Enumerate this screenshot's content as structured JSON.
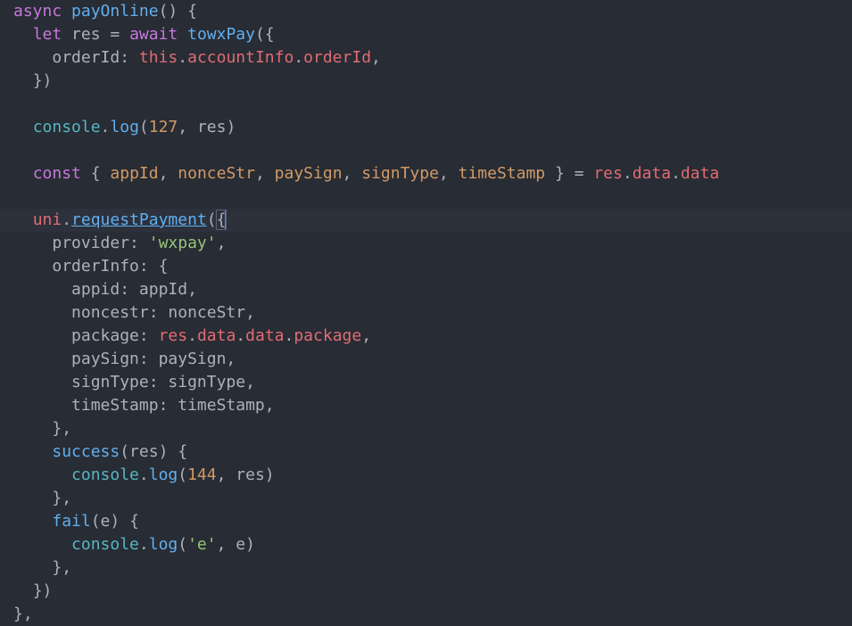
{
  "editor": {
    "lines": [
      [
        {
          "t": "async ",
          "c": "kw"
        },
        {
          "t": "payOnline",
          "c": "fn"
        },
        {
          "t": "() {",
          "c": "punc"
        }
      ],
      [
        {
          "t": "  "
        },
        {
          "t": "let ",
          "c": "kw"
        },
        {
          "t": "res = ",
          "c": "punc"
        },
        {
          "t": "await ",
          "c": "kw"
        },
        {
          "t": "towxPay",
          "c": "fn"
        },
        {
          "t": "({",
          "c": "punc"
        }
      ],
      [
        {
          "t": "    "
        },
        {
          "t": "orderId: ",
          "c": "prop"
        },
        {
          "t": "this",
          "c": "var"
        },
        {
          "t": ".",
          "c": "punc"
        },
        {
          "t": "accountInfo",
          "c": "var"
        },
        {
          "t": ".",
          "c": "punc"
        },
        {
          "t": "orderId",
          "c": "var"
        },
        {
          "t": ",",
          "c": "punc"
        }
      ],
      [
        {
          "t": "  "
        },
        {
          "t": "})",
          "c": "punc"
        }
      ],
      [],
      [
        {
          "t": "  "
        },
        {
          "t": "console",
          "c": "cls"
        },
        {
          "t": ".",
          "c": "punc"
        },
        {
          "t": "log",
          "c": "fn"
        },
        {
          "t": "(",
          "c": "punc"
        },
        {
          "t": "127",
          "c": "num"
        },
        {
          "t": ", res)",
          "c": "punc"
        }
      ],
      [],
      [
        {
          "t": "  "
        },
        {
          "t": "const ",
          "c": "kw"
        },
        {
          "t": "{ ",
          "c": "punc"
        },
        {
          "t": "appId",
          "c": "param"
        },
        {
          "t": ", ",
          "c": "punc"
        },
        {
          "t": "nonceStr",
          "c": "param"
        },
        {
          "t": ", ",
          "c": "punc"
        },
        {
          "t": "paySign",
          "c": "param"
        },
        {
          "t": ", ",
          "c": "punc"
        },
        {
          "t": "signType",
          "c": "param"
        },
        {
          "t": ", ",
          "c": "punc"
        },
        {
          "t": "timeStamp",
          "c": "param"
        },
        {
          "t": " } = ",
          "c": "punc"
        },
        {
          "t": "res",
          "c": "var"
        },
        {
          "t": ".",
          "c": "punc"
        },
        {
          "t": "data",
          "c": "var"
        },
        {
          "t": ".",
          "c": "punc"
        },
        {
          "t": "data",
          "c": "var"
        }
      ],
      [],
      [
        {
          "t": "  "
        },
        {
          "t": "uni",
          "c": "var"
        },
        {
          "t": ".",
          "c": "punc"
        },
        {
          "t": "requestPayment",
          "c": "link"
        },
        {
          "t": "(",
          "c": "punc"
        },
        {
          "t": "{",
          "c": "punc bracket-hl"
        },
        {
          "t": "",
          "c": "cursor"
        }
      ],
      [
        {
          "t": "    "
        },
        {
          "t": "provider: ",
          "c": "prop"
        },
        {
          "t": "'wxpay'",
          "c": "str"
        },
        {
          "t": ",",
          "c": "punc"
        }
      ],
      [
        {
          "t": "    "
        },
        {
          "t": "orderInfo: {",
          "c": "prop"
        }
      ],
      [
        {
          "t": "      "
        },
        {
          "t": "appid: appId,",
          "c": "prop"
        }
      ],
      [
        {
          "t": "      "
        },
        {
          "t": "noncestr: nonceStr,",
          "c": "prop"
        }
      ],
      [
        {
          "t": "      "
        },
        {
          "t": "package: ",
          "c": "prop"
        },
        {
          "t": "res",
          "c": "var"
        },
        {
          "t": ".",
          "c": "punc"
        },
        {
          "t": "data",
          "c": "var"
        },
        {
          "t": ".",
          "c": "punc"
        },
        {
          "t": "data",
          "c": "var"
        },
        {
          "t": ".",
          "c": "punc"
        },
        {
          "t": "package",
          "c": "var"
        },
        {
          "t": ",",
          "c": "punc"
        }
      ],
      [
        {
          "t": "      "
        },
        {
          "t": "paySign: paySign,",
          "c": "prop"
        }
      ],
      [
        {
          "t": "      "
        },
        {
          "t": "signType: signType,",
          "c": "prop"
        }
      ],
      [
        {
          "t": "      "
        },
        {
          "t": "timeStamp: timeStamp,",
          "c": "prop"
        }
      ],
      [
        {
          "t": "    "
        },
        {
          "t": "},",
          "c": "punc"
        }
      ],
      [
        {
          "t": "    "
        },
        {
          "t": "success",
          "c": "fn"
        },
        {
          "t": "(res) {",
          "c": "punc"
        }
      ],
      [
        {
          "t": "      "
        },
        {
          "t": "console",
          "c": "cls"
        },
        {
          "t": ".",
          "c": "punc"
        },
        {
          "t": "log",
          "c": "fn"
        },
        {
          "t": "(",
          "c": "punc"
        },
        {
          "t": "144",
          "c": "num"
        },
        {
          "t": ", res)",
          "c": "punc"
        }
      ],
      [
        {
          "t": "    "
        },
        {
          "t": "},",
          "c": "punc"
        }
      ],
      [
        {
          "t": "    "
        },
        {
          "t": "fail",
          "c": "fn"
        },
        {
          "t": "(e) {",
          "c": "punc"
        }
      ],
      [
        {
          "t": "      "
        },
        {
          "t": "console",
          "c": "cls"
        },
        {
          "t": ".",
          "c": "punc"
        },
        {
          "t": "log",
          "c": "fn"
        },
        {
          "t": "(",
          "c": "punc"
        },
        {
          "t": "'e'",
          "c": "str"
        },
        {
          "t": ", e)",
          "c": "punc"
        }
      ],
      [
        {
          "t": "    "
        },
        {
          "t": "},",
          "c": "punc"
        }
      ],
      [
        {
          "t": "  "
        },
        {
          "t": "})",
          "c": "punc"
        }
      ],
      [
        {
          "t": "},",
          "c": "punc"
        }
      ]
    ],
    "current_line": 9
  }
}
